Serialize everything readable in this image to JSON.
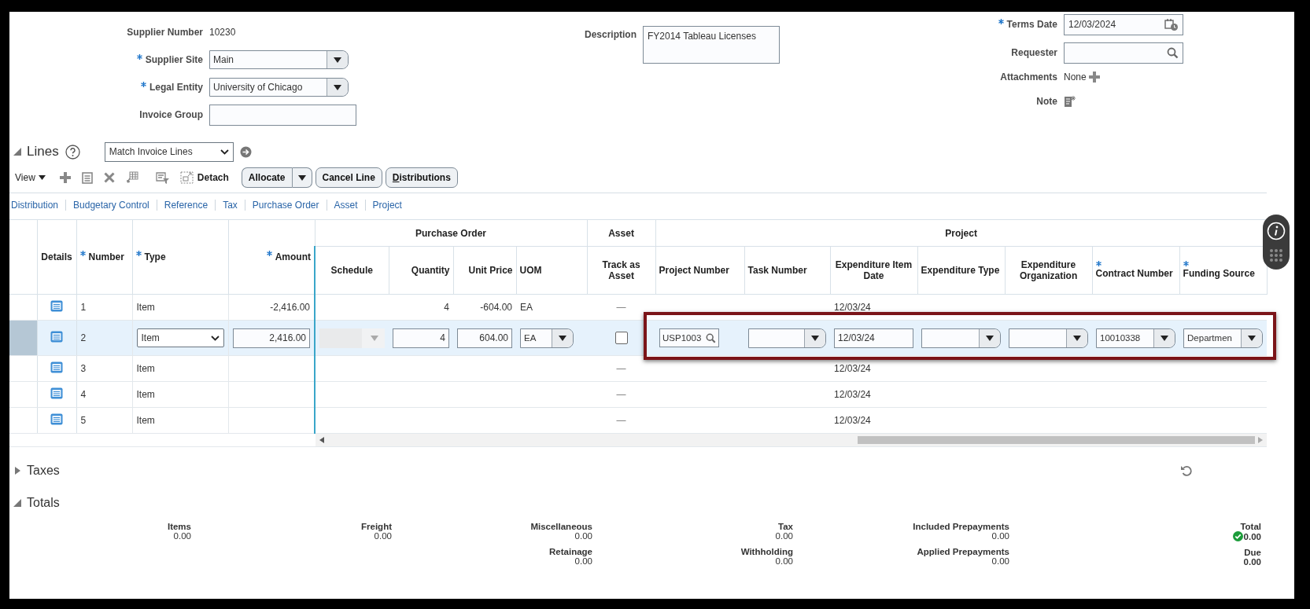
{
  "header": {
    "columns": [
      {
        "fields": [
          {
            "label": "Supplier Number",
            "required": false,
            "kind": "text",
            "value": "10230"
          },
          {
            "label": "Supplier Site",
            "required": true,
            "kind": "select",
            "value": "Main"
          },
          {
            "label": "Legal Entity",
            "required": true,
            "kind": "select",
            "value": "University of Chicago"
          },
          {
            "label": "Invoice Group",
            "required": false,
            "kind": "input"
          }
        ]
      },
      {
        "fields": [
          {
            "label": "Description",
            "required": false,
            "kind": "textarea",
            "value": "FY2014 Tableau Licenses"
          }
        ]
      },
      {
        "fields": [
          {
            "label": "Terms Date",
            "required": true,
            "kind": "date",
            "value": "12/03/2024"
          },
          {
            "label": "Requester",
            "required": false,
            "kind": "search"
          },
          {
            "label": "Attachments",
            "required": false,
            "kind": "attachments",
            "value": "None"
          },
          {
            "label": "Note",
            "required": false,
            "kind": "note"
          }
        ]
      }
    ]
  },
  "lines": {
    "title": "Lines",
    "expanded": true,
    "action_select": "Match Invoice Lines",
    "view_menu": "View",
    "detach": "Detach",
    "buttons": [
      {
        "label": "Allocate",
        "kind": "split",
        "mnemonic": false
      },
      {
        "label": "Cancel Line",
        "kind": "plain",
        "mnemonic": false
      },
      {
        "label": "Distributions",
        "kind": "plain",
        "mnemonic": true
      }
    ],
    "links": [
      "Distribution",
      "Budgetary Control",
      "Reference",
      "Tax",
      "Purchase Order",
      "Asset",
      "Project"
    ],
    "table": {
      "headings": [
        {
          "kind": "column",
          "label": "Details",
          "required": false
        },
        {
          "kind": "column",
          "label": "Number",
          "required": true
        },
        {
          "kind": "column",
          "label": "Type",
          "required": true
        },
        {
          "kind": "column",
          "label": "Amount",
          "required": true
        },
        {
          "kind": "group",
          "label": "Purchase Order",
          "columns": [
            {
              "label": "Schedule",
              "required": false
            },
            {
              "label": "Quantity",
              "required": false
            },
            {
              "label": "Unit Price",
              "required": false
            },
            {
              "label": "UOM",
              "required": false
            }
          ]
        },
        {
          "kind": "group",
          "label": "Asset",
          "columns": [
            {
              "label": "Track as Asset",
              "required": false
            }
          ]
        },
        {
          "kind": "group",
          "label": "Project",
          "columns": [
            {
              "label": "Project Number",
              "required": false
            },
            {
              "label": "Task Number",
              "required": false
            },
            {
              "label": "Expenditure Item Date",
              "required": false
            },
            {
              "label": "Expenditure Type",
              "required": false
            },
            {
              "label": "Expenditure Organization",
              "required": false
            },
            {
              "label": "Contract Number",
              "required": true
            },
            {
              "label": "Funding Source",
              "required": true
            }
          ]
        }
      ],
      "rows": [
        {
          "selected": false,
          "highlighted": false,
          "cells": [
            {
              "kind": "details"
            },
            "1",
            "Item",
            "-2,416.00",
            null,
            "4",
            "-604.00",
            "EA",
            "—",
            null,
            null,
            "12/03/24",
            null,
            null,
            null,
            null
          ]
        },
        {
          "selected": true,
          "highlighted": true,
          "cells": [
            {
              "kind": "details"
            },
            "2",
            {
              "kind": "select",
              "value": "Item"
            },
            {
              "kind": "input",
              "value": "2,416.00"
            },
            {
              "kind": "disabled"
            },
            {
              "kind": "input",
              "value": "4"
            },
            {
              "kind": "input",
              "value": "604.00"
            },
            {
              "kind": "combo",
              "value": "EA"
            },
            {
              "kind": "checkbox",
              "checked": false
            },
            {
              "kind": "search",
              "value": "USP1003"
            },
            {
              "kind": "combo"
            },
            {
              "kind": "input",
              "value": "12/03/24"
            },
            {
              "kind": "combo"
            },
            {
              "kind": "combo"
            },
            {
              "kind": "combo",
              "value": "10010338"
            },
            {
              "kind": "combo",
              "value": "Departmen"
            }
          ]
        },
        {
          "selected": false,
          "highlighted": false,
          "cells": [
            {
              "kind": "details"
            },
            "3",
            "Item",
            null,
            null,
            null,
            null,
            null,
            "—",
            null,
            null,
            "12/03/24",
            null,
            null,
            null,
            null
          ]
        },
        {
          "selected": false,
          "highlighted": false,
          "cells": [
            {
              "kind": "details"
            },
            "4",
            "Item",
            null,
            null,
            null,
            null,
            null,
            "—",
            null,
            null,
            "12/03/24",
            null,
            null,
            null,
            null
          ]
        },
        {
          "selected": false,
          "highlighted": false,
          "cells": [
            {
              "kind": "details"
            },
            "5",
            "Item",
            null,
            null,
            null,
            null,
            null,
            "—",
            null,
            null,
            "12/03/24",
            null,
            null,
            null,
            null
          ]
        }
      ]
    }
  },
  "taxes": {
    "title": "Taxes",
    "expanded": false
  },
  "totals": {
    "title": "Totals",
    "expanded": true,
    "columns": [
      {
        "items": [
          {
            "label": "Items",
            "value": "0.00"
          }
        ]
      },
      {
        "items": [
          {
            "label": "Freight",
            "value": "0.00"
          }
        ]
      },
      {
        "items": [
          {
            "label": "Miscellaneous",
            "value": "0.00"
          },
          {
            "label": "Retainage",
            "value": "0.00"
          }
        ]
      },
      {
        "items": [
          {
            "label": "Tax",
            "value": "0.00"
          },
          {
            "label": "Withholding",
            "value": "0.00"
          }
        ]
      },
      {
        "items": [
          {
            "label": "Included Prepayments",
            "value": "0.00"
          },
          {
            "label": "Applied Prepayments",
            "value": "0.00"
          }
        ]
      },
      {
        "items": [
          {
            "label": "Total",
            "value": "0.00",
            "valid": true,
            "strong": true
          },
          {
            "label": "Due",
            "value": "0.00",
            "strong": true
          }
        ]
      }
    ]
  }
}
